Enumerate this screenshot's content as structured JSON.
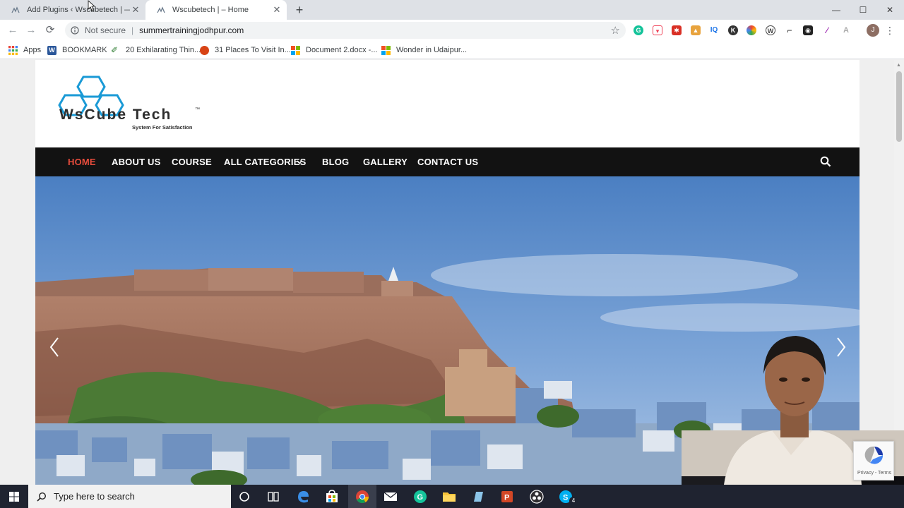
{
  "browser": {
    "tabs": [
      {
        "title": "Add Plugins ‹ Wscubetech | — W",
        "active": false
      },
      {
        "title": "Wscubetech | – Home",
        "active": true
      }
    ],
    "new_tab_symbol": "+",
    "window_controls": {
      "minimize": "—",
      "maximize": "☐",
      "close": "✕"
    },
    "nav": {
      "back": "←",
      "forward": "→",
      "reload": "⟳"
    },
    "address": {
      "security_label": "Not secure",
      "url": "summertrainingjodhpur.com"
    },
    "profile_initial": "J",
    "extensions": [
      "grammarly-icon",
      "pocket-icon",
      "pdf-icon",
      "image-icon",
      "iq-icon",
      "k-icon",
      "colorpicker-icon",
      "wordpress-icon",
      "crop-icon",
      "camera-icon",
      "pen-icon",
      "font-icon"
    ],
    "bookmarks": [
      {
        "label": "Apps",
        "icon": "apps-grid-icon"
      },
      {
        "label": "BOOKMARK",
        "icon": "word-icon"
      },
      {
        "label": "20 Exhilarating Thin...",
        "icon": "leaf-icon"
      },
      {
        "label": "31 Places To Visit In...",
        "icon": "map-icon"
      },
      {
        "label": "Document 2.docx -...",
        "icon": "windows-icon"
      },
      {
        "label": "Wonder in Udaipur...",
        "icon": "windows-icon"
      }
    ]
  },
  "site": {
    "logo": {
      "brand": "WsCube Tech",
      "trademark": "™",
      "tagline": "System For Satisfaction"
    },
    "nav": [
      {
        "label": "HOME",
        "active": true
      },
      {
        "label": "ABOUT US",
        "active": false
      },
      {
        "label": "COURSE",
        "active": false
      },
      {
        "label": "ALL CATEGORIES",
        "active": false,
        "dropdown": true
      },
      {
        "label": "BLOG",
        "active": false
      },
      {
        "label": "GALLERY",
        "active": false
      },
      {
        "label": "CONTACT US",
        "active": false
      }
    ],
    "accent_color": "#e74c3c",
    "hero": {
      "arrows": [
        "prev-arrow-icon",
        "next-arrow-icon"
      ]
    },
    "recaptcha": {
      "terms": "Privacy - Terms"
    }
  },
  "taskbar": {
    "search_placeholder": "Type here to search",
    "skype_badge": "4",
    "apps": [
      "cortana-icon",
      "task-view-icon",
      "edge-icon",
      "store-icon",
      "chrome-icon",
      "mail-icon",
      "grammarly-icon",
      "file-explorer-icon",
      "notes-icon",
      "powerpoint-icon",
      "obs-icon",
      "skype-icon"
    ]
  }
}
